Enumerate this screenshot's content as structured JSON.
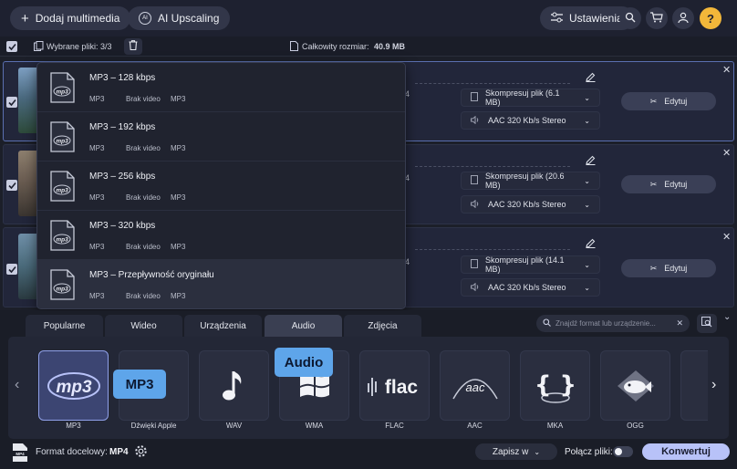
{
  "toolbar": {
    "add_media": "Dodaj multimedia",
    "ai_upscaling": "AI Upscaling",
    "settings": "Ustawienia"
  },
  "subbar": {
    "selected_label": "Wybrane pliki: 3/3",
    "total_size_label": "Całkowity rozmiar:",
    "total_size_value": "40.9 MB"
  },
  "files": [
    {
      "size": "Skompresuj plik (6.1 MB)",
      "audio": "AAC 320 Kb/s Stereo",
      "edit": "Edytuj",
      "partial": "4"
    },
    {
      "size": "Skompresuj plik (20.6 MB)",
      "audio": "AAC 320 Kb/s Stereo",
      "edit": "Edytuj",
      "partial": "4"
    },
    {
      "size": "Skompresuj plik (14.1 MB)",
      "audio": "AAC 320 Kb/s Stereo",
      "edit": "Edytuj",
      "partial": "4"
    }
  ],
  "presets": [
    {
      "title": "MP3 – 128 kbps",
      "video": "MP3",
      "novideo": "Brak video",
      "audio": "MP3"
    },
    {
      "title": "MP3 – 192 kbps",
      "video": "MP3",
      "novideo": "Brak video",
      "audio": "MP3"
    },
    {
      "title": "MP3 – 256 kbps",
      "video": "MP3",
      "novideo": "Brak video",
      "audio": "MP3"
    },
    {
      "title": "MP3 – 320 kbps",
      "video": "MP3",
      "novideo": "Brak video",
      "audio": "MP3"
    },
    {
      "title": "MP3 – Przepływność oryginału",
      "video": "MP3",
      "novideo": "Brak video",
      "audio": "MP3"
    }
  ],
  "tabs": [
    "Popularne",
    "Wideo",
    "Urządzenia",
    "Audio",
    "Zdjęcia"
  ],
  "active_tab": "Audio",
  "search": {
    "placeholder": "Znajdź format lub urządzenie..."
  },
  "formats": [
    "MP3",
    "Dźwięki Apple",
    "WAV",
    "WMA",
    "FLAC",
    "AAC",
    "MKA",
    "OGG"
  ],
  "tooltips": {
    "audio": "Audio",
    "mp3": "MP3"
  },
  "card_text": {
    "mp3": "mp3",
    "flac": "flac",
    "aac": "aac"
  },
  "footer": {
    "target_label": "Format docelowy:",
    "target_value": "MP4",
    "save_to": "Zapisz w",
    "merge": "Połącz pliki:",
    "convert": "Konwertuj"
  },
  "colors": {
    "accent": "#8fa0e8",
    "convert_bg": "#b8c2f8",
    "tooltip_bg": "#5ea5ea",
    "help_bg": "#f2b73a"
  }
}
